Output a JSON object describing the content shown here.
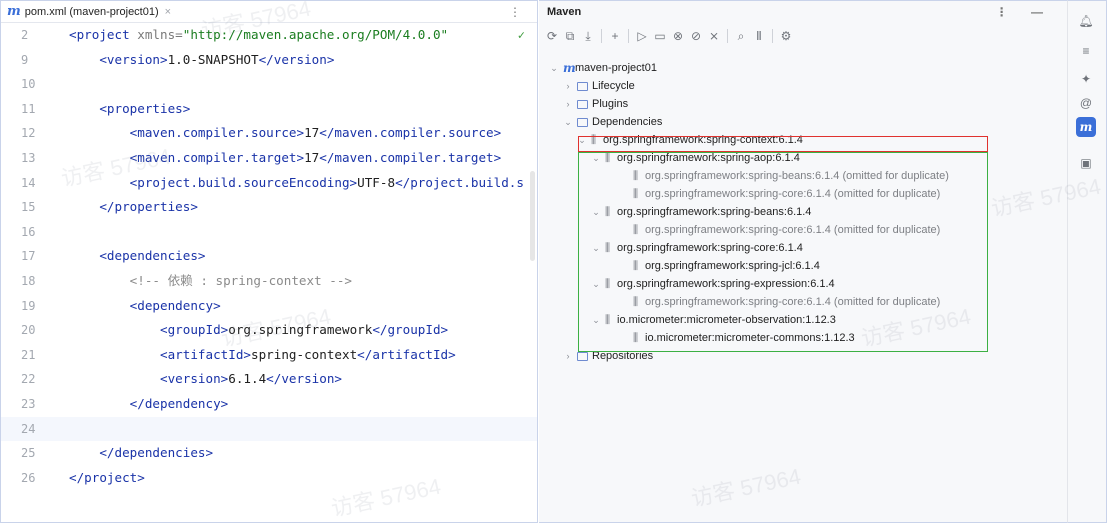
{
  "editor": {
    "tab": {
      "icon": "m",
      "label": "pom.xml (maven-project01)",
      "close": "×"
    },
    "more": "⋮",
    "check": "✓",
    "lines": [
      {
        "no": "2",
        "html": "<span class=\"tag\">&lt;project </span><span class=\"attr\">xmlns=</span><span class=\"val\">\"http://maven.apache.org/POM/4.0.0\"</span>"
      },
      {
        "no": "9",
        "html": "    <span class=\"tag\">&lt;version&gt;</span>1.0-SNAPSHOT<span class=\"tag\">&lt;/version&gt;</span>"
      },
      {
        "no": "10",
        "html": ""
      },
      {
        "no": "11",
        "html": "    <span class=\"tag\">&lt;properties&gt;</span>"
      },
      {
        "no": "12",
        "html": "        <span class=\"tag\">&lt;maven.compiler.source&gt;</span>17<span class=\"tag\">&lt;/maven.compiler.source&gt;</span>"
      },
      {
        "no": "13",
        "html": "        <span class=\"tag\">&lt;maven.compiler.target&gt;</span>17<span class=\"tag\">&lt;/maven.compiler.target&gt;</span>"
      },
      {
        "no": "14",
        "html": "        <span class=\"tag\">&lt;project.build.sourceEncoding&gt;</span>UTF-8<span class=\"tag\">&lt;/project.build.s</span>"
      },
      {
        "no": "15",
        "html": "    <span class=\"tag\">&lt;/properties&gt;</span>"
      },
      {
        "no": "16",
        "html": ""
      },
      {
        "no": "17",
        "html": "    <span class=\"tag\">&lt;dependencies&gt;</span>"
      },
      {
        "no": "18",
        "html": "        <span class=\"cmt\">&lt;!-- 依赖 : spring-context --&gt;</span>"
      },
      {
        "no": "19",
        "html": "        <span class=\"tag\">&lt;dependency&gt;</span>"
      },
      {
        "no": "20",
        "html": "            <span class=\"tag\">&lt;groupId&gt;</span>org.springframework<span class=\"tag\">&lt;/groupId&gt;</span>"
      },
      {
        "no": "21",
        "html": "            <span class=\"tag\">&lt;artifactId&gt;</span>spring-context<span class=\"tag\">&lt;/artifactId&gt;</span>"
      },
      {
        "no": "22",
        "html": "            <span class=\"tag\">&lt;version&gt;</span>6.1.4<span class=\"tag\">&lt;/version&gt;</span>"
      },
      {
        "no": "23",
        "html": "        <span class=\"tag\">&lt;/dependency&gt;</span>"
      },
      {
        "no": "24",
        "html": "",
        "current": true
      },
      {
        "no": "25",
        "html": "    <span class=\"tag\">&lt;/dependencies&gt;</span>"
      },
      {
        "no": "26",
        "html": "<span class=\"tag\">&lt;/project&gt;</span>"
      }
    ]
  },
  "maven": {
    "title": "Maven",
    "header_actions": "⋮ —",
    "toolbar": [
      "⟳",
      "⧉",
      "⤓",
      "+",
      "▷",
      "▭",
      "⊗",
      "⊘",
      "⨯",
      "⌕",
      "Ⅱ",
      "⚙"
    ],
    "tree": [
      {
        "level": 0,
        "chev": "⌄",
        "icon": "m",
        "label": "maven-project01"
      },
      {
        "level": 1,
        "chev": "›",
        "icon": "folder",
        "label": "Lifecycle"
      },
      {
        "level": 1,
        "chev": "›",
        "icon": "folder",
        "label": "Plugins"
      },
      {
        "level": 1,
        "chev": "⌄",
        "icon": "folder",
        "label": "Dependencies"
      },
      {
        "level": 2,
        "chev": "⌄",
        "icon": "lib",
        "label": "org.springframework:spring-context:6.1.4"
      },
      {
        "level": 3,
        "chev": "⌄",
        "icon": "lib",
        "label": "org.springframework:spring-aop:6.1.4"
      },
      {
        "level": 4,
        "chev": "",
        "icon": "lib",
        "label": "org.springframework:spring-beans:6.1.4 (omitted for duplicate)",
        "omitted": true
      },
      {
        "level": 4,
        "chev": "",
        "icon": "lib",
        "label": "org.springframework:spring-core:6.1.4 (omitted for duplicate)",
        "omitted": true
      },
      {
        "level": 3,
        "chev": "⌄",
        "icon": "lib",
        "label": "org.springframework:spring-beans:6.1.4"
      },
      {
        "level": 4,
        "chev": "",
        "icon": "lib",
        "label": "org.springframework:spring-core:6.1.4 (omitted for duplicate)",
        "omitted": true
      },
      {
        "level": 3,
        "chev": "⌄",
        "icon": "lib",
        "label": "org.springframework:spring-core:6.1.4"
      },
      {
        "level": 4,
        "chev": "",
        "icon": "lib",
        "label": "org.springframework:spring-jcl:6.1.4"
      },
      {
        "level": 3,
        "chev": "⌄",
        "icon": "lib",
        "label": "org.springframework:spring-expression:6.1.4"
      },
      {
        "level": 4,
        "chev": "",
        "icon": "lib",
        "label": "org.springframework:spring-core:6.1.4 (omitted for duplicate)",
        "omitted": true
      },
      {
        "level": 3,
        "chev": "⌄",
        "icon": "lib",
        "label": "io.micrometer:micrometer-observation:1.12.3"
      },
      {
        "level": 4,
        "chev": "",
        "icon": "lib",
        "label": "io.micrometer:micrometer-commons:1.12.3"
      },
      {
        "level": 1,
        "chev": "›",
        "icon": "folder",
        "label": "Repositories"
      }
    ]
  },
  "strip": {
    "buttons": [
      {
        "name": "notifications-icon",
        "glyph": "🔔︎"
      },
      {
        "name": "database-icon",
        "glyph": "≡"
      },
      {
        "name": "ai-assistant-icon",
        "glyph": "✦"
      },
      {
        "name": "copilot-icon",
        "glyph": "@"
      },
      {
        "name": "maven-icon",
        "glyph": "m",
        "active": true
      },
      {
        "name": "structure-icon",
        "glyph": "▣"
      }
    ]
  },
  "watermark": "访客 57964"
}
